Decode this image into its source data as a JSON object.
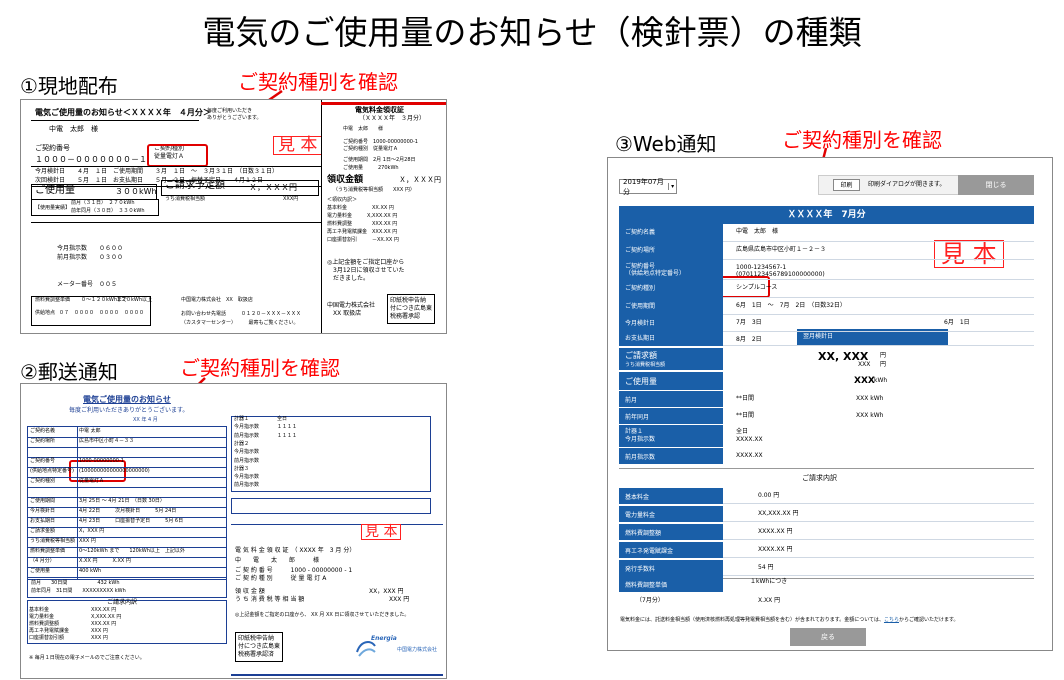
{
  "title": "電気のご使用量のお知らせ（検針票）の種類",
  "note_label": "ご契約種別を確認",
  "sections": {
    "s1": "①現地配布",
    "s2": "②郵送通知",
    "s3": "③Web通知"
  },
  "stamp_text": "見 本",
  "doc1": {
    "heading": "電気ご使用量のお知らせ＜ＸＸＸＸ年　４月分＞",
    "side_note": "毎度ご利用いただき\nありがとうございます。",
    "customer": "中電　太郎　様",
    "contract_no_label": "ご契約番号",
    "contract_no": "１０００－０００００００－１",
    "contract_type_label": "ご契約種別",
    "contract_type": "従量電灯Ａ",
    "meter_read_this": "今月検針日　　４月　１日　ご使用期間　　３月　１日　～　３月３１日　（日数３１日）",
    "meter_read_next": "次回検針日　　５月　１日　お支払期日　　５月　２日　振替予定日　　４月１２日",
    "usage_label": "ご使用量",
    "usage_value": "３００kWh",
    "billing_plan_label": "ご請求予定額",
    "billing_plan_value": "Ｘ，ＸＸＸ円",
    "tax_note": "うち消費税相当額",
    "tax_value": "XXX円",
    "compare_label": "【使用量実績】",
    "compare_rows": [
      "前月（３１日）　２７０kWh",
      "前年同月（３０日）　３３０kWh"
    ],
    "fuel_rows": [
      "燃料費調整単価",
      "０～１２０kWhまで",
      "１２０kWh以上",
      "供給地点",
      "０７　００００　００００　００００"
    ],
    "receipt_title": "電気料金領収証",
    "receipt_month": "（ＸＸＸＸ年　３月分）",
    "receipt_customer": "中電　太郎　　様",
    "receipt_lines": [
      "ご契約番号　1000-00000000-1",
      "ご契約種別　従量電灯Ａ",
      "ご使用期間　2月 1日～2月28日",
      "ご使用量　　　270kWh"
    ],
    "receipt_amount_label": "領収金額",
    "receipt_amount": "Ｘ，ＸＸＸ円",
    "receipt_tax": "（うち消費税等相当額　　XXX 円）",
    "receipt_detail_title": "＜領収内訳＞",
    "receipt_detail": [
      "基本料金　　　　　XX.XX 円",
      "電力量料金　　　X,XXX.XX 円",
      "燃料費調整　　　　XXX.XX 円",
      "再エネ発電賦課金　XXX.XX 円",
      "口座振替割引　　　－XX.XX 円"
    ],
    "receipt_notice": "◎上記金額をご指定口座から\n　3月12日に領収させていた\n　だきました。",
    "receipt_company": "中国電力株式会社\n　XX 取扱店",
    "receipt_stamp": "印紙税申告納\n付につき広島東\n税務署承認",
    "meter_lines": [
      "今月指示数　　０６００",
      "前月指示数　　０３００",
      "メーター番号　００５"
    ],
    "company_line": "中国電力株式会社　XX　取扱店",
    "contact_line": "お問い合わせ先電話　　　０１２０－ＸＸＸ－ＸＸＸ",
    "contact_sub": "（カスタマーセンター）　　　最寄もご覧ください。"
  },
  "doc2": {
    "heading": "電気ご使用量のお知らせ",
    "subheading": "毎度ご利用いただきありがとうございます。",
    "month": "XX 年 4 月",
    "rows": [
      [
        "ご契約名義",
        "中電 太郎"
      ],
      [
        "ご契約場所",
        "広島市中区小町４－３３"
      ],
      [
        "",
        ""
      ],
      [
        "ご契約番号",
        "1000-00000000-1"
      ],
      [
        "(供給地点特定番号)",
        "(100000000000000000000)"
      ],
      [
        "ご契約種別",
        "従量電灯Ａ"
      ],
      [
        "",
        ""
      ],
      [
        "ご使用期間",
        "3月 25日 ～ 4月 21日　（日数 30日）"
      ],
      [
        "今月検針日",
        "4月 22日　　　次月検針日　　　5月 24日"
      ],
      [
        "お支払期日",
        "4月 23日　　　口座振替予定日　　　5月 6日"
      ],
      [
        "ご請求金額",
        "X，XXX 円"
      ],
      [
        "うち消費税等相当額",
        "XXX 円"
      ],
      [
        "燃料費調整単価",
        "0〜120kWh まで　　120kWh以上　上記以外"
      ],
      [
        "（4 月分）",
        "X.XX 円　　　X.XX 円"
      ],
      [
        "ご使用量",
        "400 kWh"
      ]
    ],
    "history": [
      "前月　　30日間　　　　　　432 kWh",
      "前年同月　31日間　　XXXXXXXXX kWh"
    ],
    "detail_title": "ご請求内訳",
    "detail": [
      [
        "基本料金",
        "XXX.XX 円"
      ],
      [
        "電力量料金",
        "X,XXX.XX 円"
      ],
      [
        "燃料費調整額",
        "XXX.XX 円"
      ],
      [
        "再エネ発電賦課金",
        "XXX 円"
      ],
      [
        "口座振替割引額",
        "XXX 円"
      ]
    ],
    "footer_note": "※ 毎月１日現在の電子メールのでご注意ください。",
    "meters": [
      [
        "計器１",
        "全日"
      ],
      [
        "今月指示数",
        "１１１１"
      ],
      [
        "前月指示数",
        "１１１１"
      ],
      [
        "計器２",
        ""
      ],
      [
        "今月指示数",
        ""
      ],
      [
        "前月指示数",
        ""
      ],
      [
        "計器３",
        ""
      ],
      [
        "今月指示数",
        ""
      ],
      [
        "前月指示数",
        ""
      ]
    ],
    "receipt_title": "電 気 料 金 領 収 証　（ XXXX 年　3 月 分）",
    "receipt_name": "中　　電　　太　　郎　　　様",
    "receipt_no": "ご 契 約 番 号　　　1000 - 00000000 - 1",
    "receipt_type": "ご 契 約 種 別　　　従 量 電 灯 A",
    "receipt_amount_label": "領 収 金 額",
    "receipt_amount": "XX，XXX 円",
    "receipt_tax_label": "う ち 消 費 税 等 相 当 額",
    "receipt_tax": "XXX 円",
    "receipt_notice": "◎上記金額をご指定の口座から、 XX 月 XX 日に領収させていただきました。",
    "receipt_stamp": "印紙税申告納\n付につき広島東\n税務署承認済",
    "logo_text": "Energia",
    "logo_sub": "中国電力株式会社"
  },
  "web": {
    "month_select": "2019年07月分",
    "print_label": "印刷",
    "print_note": "印刷ダイアログが開きます。",
    "close_label": "閉じる",
    "header": "ＸＸＸＸ年　7月分",
    "rows": [
      [
        "ご契約名義",
        "中電　太郎　様"
      ],
      [
        "ご契約場所",
        "広島県広島市中区小町１－２－３"
      ],
      [
        "ご契約番号\n（供給地点特定番号）",
        "1000-1234567-1\n(0701123456789100000000)"
      ],
      [
        "ご契約種別",
        "シンプルコース"
      ],
      [
        "ご使用期間",
        "6月　1日　～　7月　2日　（日数32日）"
      ],
      [
        "今月検針日",
        "7月　3日"
      ],
      [
        "お支払期日",
        "8月　2日"
      ]
    ],
    "next_read_label": "翌月検針日",
    "next_read_value": "6月　1日",
    "billing_label": "ご請求額",
    "billing_sub": "うち消費税相当額",
    "billing_value": "XX, XXX",
    "billing_unit": "円",
    "billing_tax": "XXX",
    "usage_label": "ご使用量",
    "usage_value": "XXX",
    "usage_unit": "kWh",
    "usage_rows": [
      [
        "前月",
        "**日間",
        "XXX kWh"
      ],
      [
        "前年同月",
        "**日間",
        "XXX kWh"
      ]
    ],
    "meter_label": "計器１\n今月指示数",
    "meter_value": "全日\nXXXX.XX",
    "prev_meter_label": "前月指示数",
    "prev_meter_value": "XXXX.XX",
    "detail_title": "ご請求内訳",
    "detail": [
      [
        "基本料金",
        "0.00 円"
      ],
      [
        "電力量料金",
        "XX,XXX.XX 円"
      ],
      [
        "燃料費調整額",
        "XXXX.XX 円"
      ],
      [
        "再エネ発電賦課金",
        "XXXX.XX 円"
      ],
      [
        "発行手数料",
        "54 円"
      ]
    ],
    "fuel_label": "燃料費調整単価",
    "fuel_value": "１kWhにつき",
    "fuel_month": "（7月分）",
    "fuel_price": "X.XX 円",
    "footnote": "電気料金には、託送料金相当額（使用済核燃料再処理等発電費相当額を含む）が含まれております。金額については、",
    "footnote_link": "こちら",
    "footnote_end": "からご確認いただけます。",
    "back_label": "戻る"
  }
}
